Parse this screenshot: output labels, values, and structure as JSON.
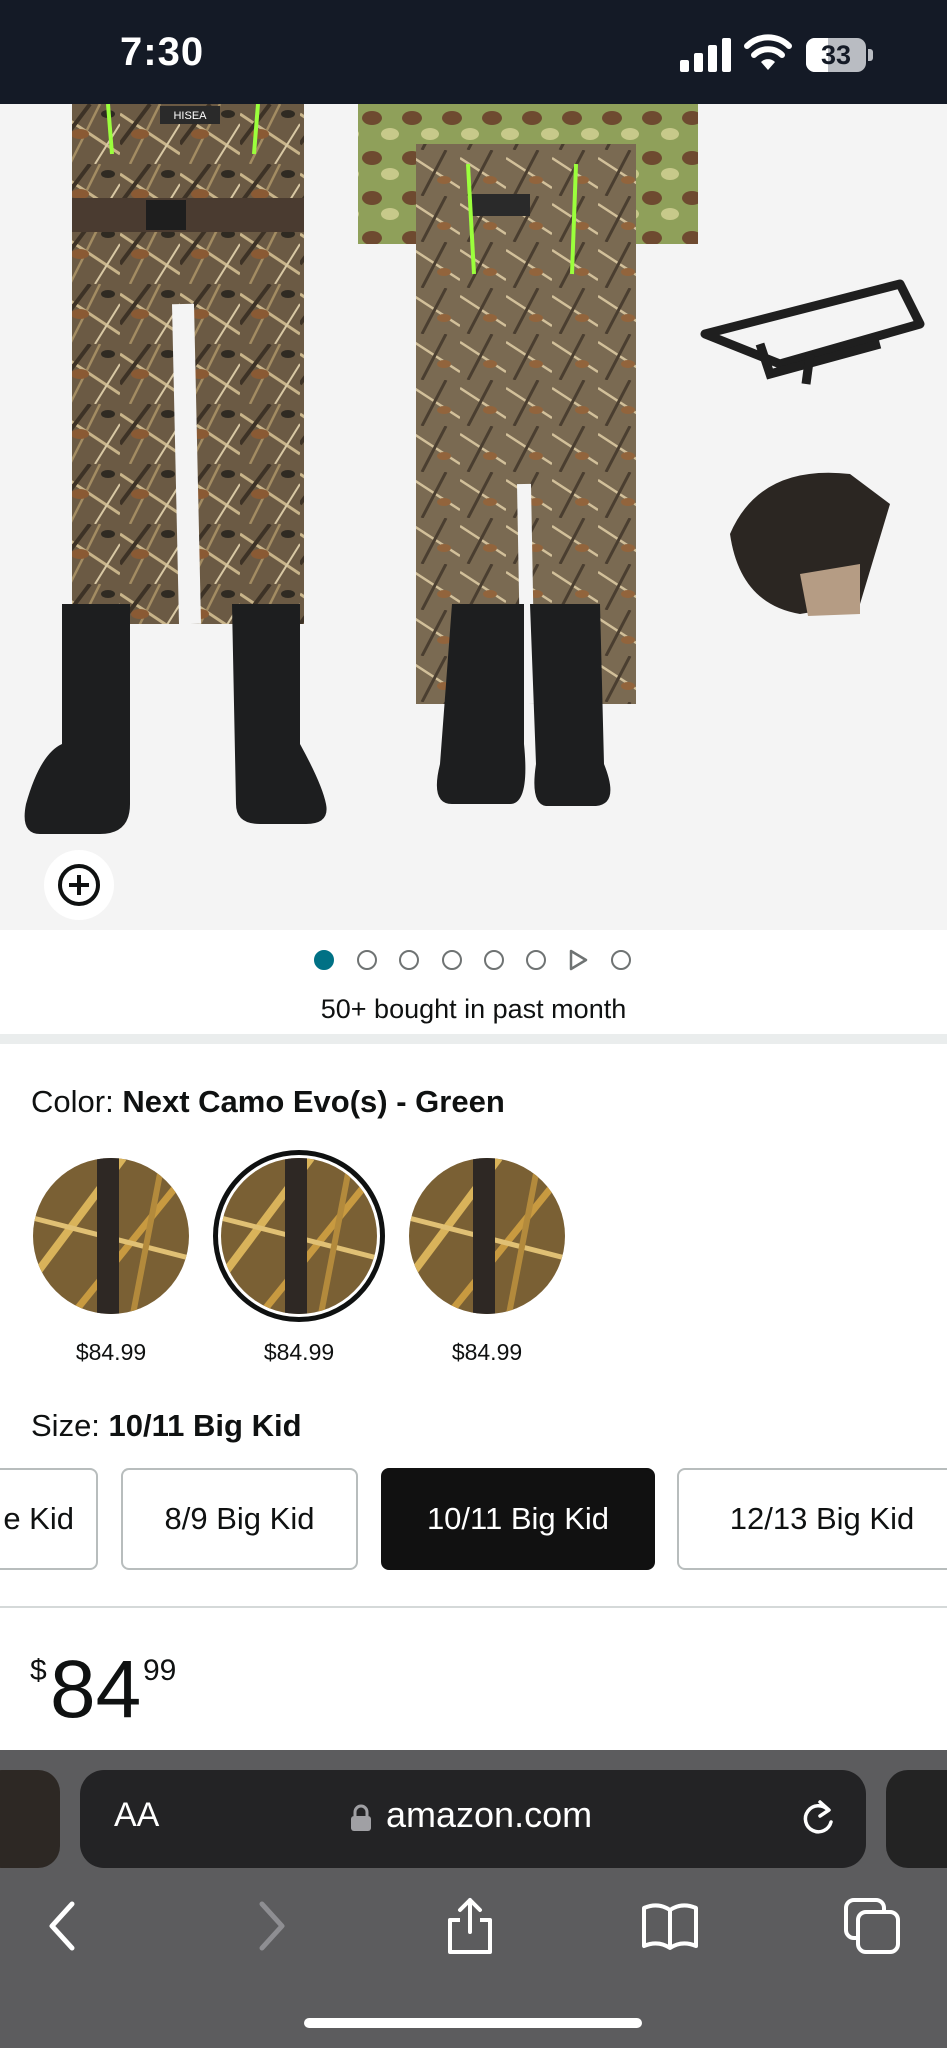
{
  "status_bar": {
    "time": "7:30",
    "battery": "33"
  },
  "gallery": {
    "logo_text": "HISEA",
    "image_count": 8,
    "active_index": 0,
    "video_index": 6
  },
  "bought_text": "50+ bought in past month",
  "color": {
    "label": "Color:",
    "value": "Next Camo Evo(s) - Green",
    "swatches": [
      {
        "price": "$84.99",
        "selected": false
      },
      {
        "price": "$84.99",
        "selected": true
      },
      {
        "price": "$84.99",
        "selected": false
      }
    ]
  },
  "size": {
    "label": "Size:",
    "value": "10/11 Big Kid",
    "options": [
      {
        "label": "e Kid",
        "selected": false
      },
      {
        "label": "8/9 Big Kid",
        "selected": false
      },
      {
        "label": "10/11 Big Kid",
        "selected": true
      },
      {
        "label": "12/13 Big Kid",
        "selected": false
      }
    ]
  },
  "price": {
    "symbol": "$",
    "whole": "84",
    "fraction": "99"
  },
  "browser": {
    "text_size_label": "AA",
    "domain": "amazon.com"
  },
  "colors": {
    "accent_dot": "#007185",
    "status_bar_bg": "#141a26",
    "selected_size_bg": "#111111"
  }
}
